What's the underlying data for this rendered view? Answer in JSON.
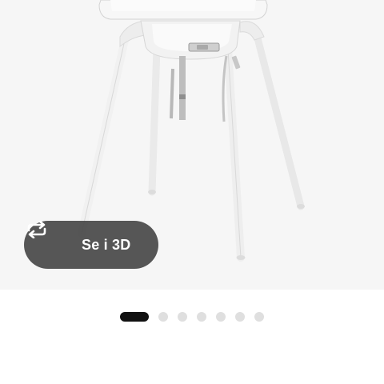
{
  "product_image": {
    "view_3d_button": {
      "label": "Se i 3D",
      "icon": "rotate-arrows-icon"
    }
  },
  "carousel": {
    "total": 7,
    "active_index": 0
  },
  "colors": {
    "image_background": "#f6f6f6",
    "button_background": "#484848",
    "dot_active": "#111111",
    "dot_inactive": "#dfdfdf"
  }
}
